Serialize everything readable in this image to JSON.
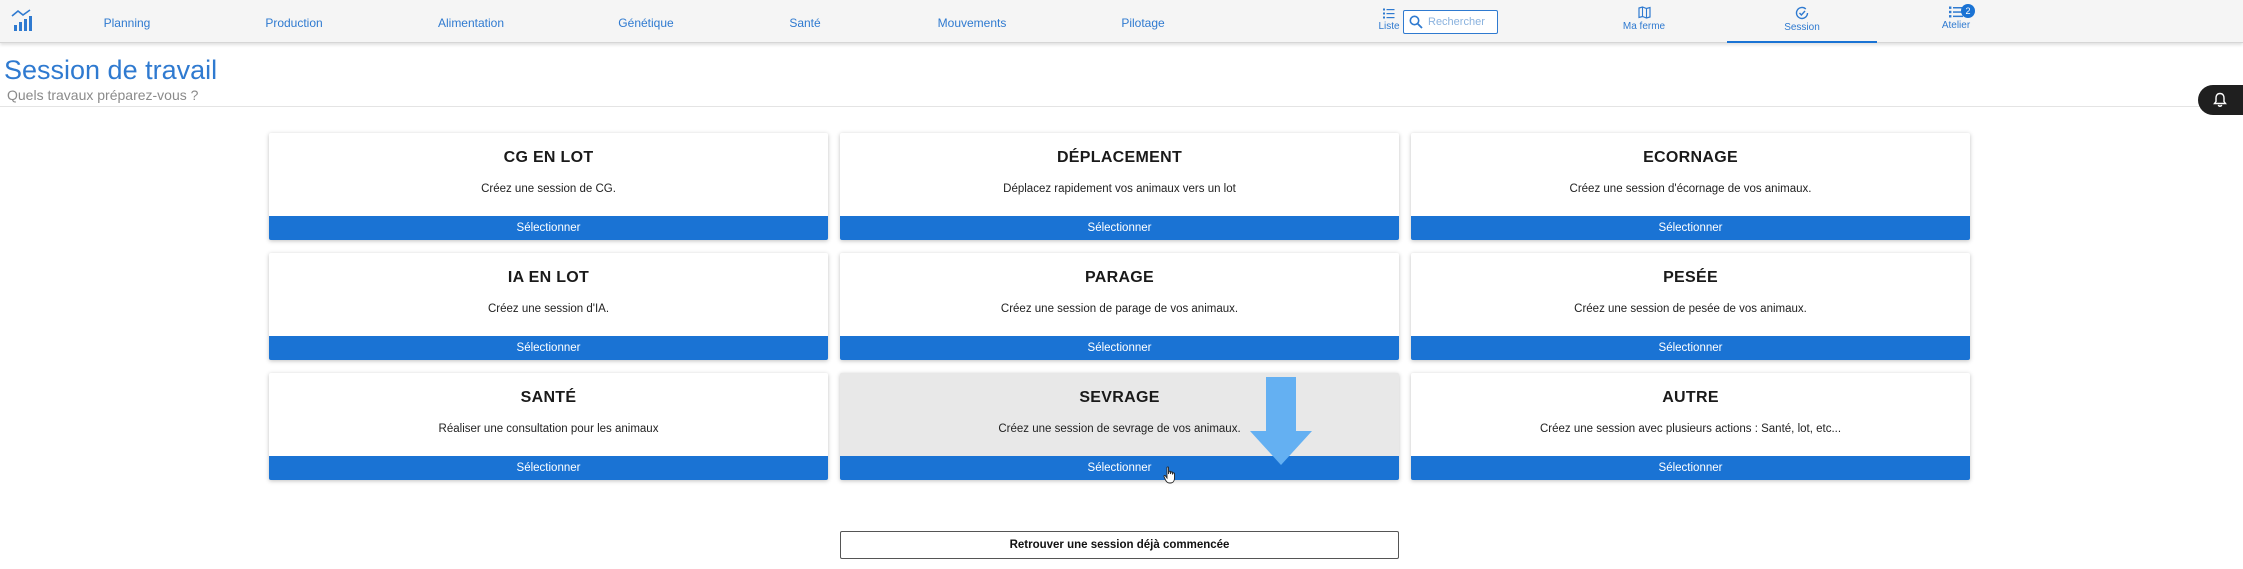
{
  "header": {
    "logo_icon": "chart-bars-icon",
    "nav": [
      "Planning",
      "Production",
      "Alimentation",
      "Génétique",
      "Santé",
      "Mouvements",
      "Pilotage"
    ],
    "liste_label": "Liste",
    "search_placeholder": "Rechercher",
    "right_nav": [
      {
        "label": "Ma ferme",
        "icon": "map-icon"
      },
      {
        "label": "Session",
        "icon": "clock-check-icon",
        "active": true
      },
      {
        "label": "Atelier",
        "icon": "list-icon",
        "badge": "2"
      }
    ]
  },
  "page": {
    "title": "Session de travail",
    "subtitle": "Quels travaux préparez-vous ?"
  },
  "cards": [
    {
      "title": "CG EN LOT",
      "desc": "Créez une session de CG.",
      "button": "Sélectionner"
    },
    {
      "title": "DÉPLACEMENT",
      "desc": "Déplacez rapidement vos animaux vers un lot",
      "button": "Sélectionner"
    },
    {
      "title": "ECORNAGE",
      "desc": "Créez une session d'écornage de vos animaux.",
      "button": "Sélectionner"
    },
    {
      "title": "IA EN LOT",
      "desc": "Créez une session d'IA.",
      "button": "Sélectionner"
    },
    {
      "title": "PARAGE",
      "desc": "Créez une session de parage de vos animaux.",
      "button": "Sélectionner"
    },
    {
      "title": "PESÉE",
      "desc": "Créez une session de pesée de vos animaux.",
      "button": "Sélectionner"
    },
    {
      "title": "SANTÉ",
      "desc": "Réaliser une consultation pour les animaux",
      "button": "Sélectionner"
    },
    {
      "title": "SEVRAGE",
      "desc": "Créez une session de sevrage de vos animaux.",
      "button": "Sélectionner"
    },
    {
      "title": "AUTRE",
      "desc": "Créez une session avec plusieurs actions : Santé, lot, etc...",
      "button": "Sélectionner"
    }
  ],
  "resume_button": "Retrouver une session déjà commencée",
  "colors": {
    "primary": "#1a73d4",
    "link": "#2f7ad0",
    "hover_card": "#e8e8e8",
    "arrow": "#64b0f2"
  }
}
